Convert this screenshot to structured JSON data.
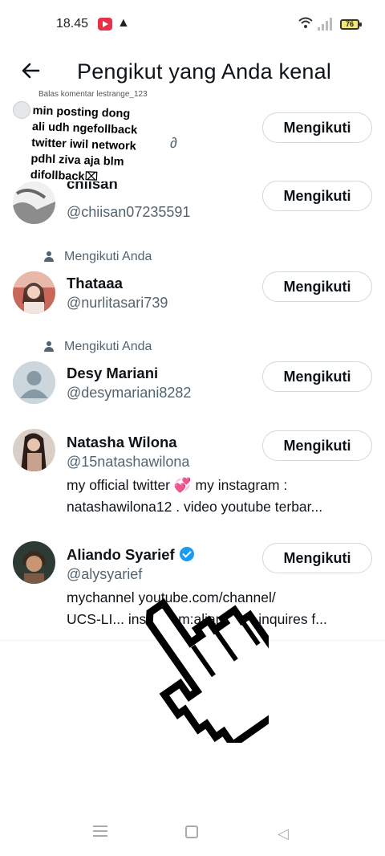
{
  "status_bar": {
    "time": "18.45",
    "battery": "76"
  },
  "header": {
    "title": "Pengikut yang Anda kenal"
  },
  "overlay_comment": {
    "reply_label": "Balas komentar lestrange_123",
    "lines": [
      "min posting dong",
      "ali udh ngefollback",
      "twitter iwil network",
      "pdhl ziva aja blm",
      "difollback⌧"
    ]
  },
  "users": [
    {
      "name": "",
      "handle": "",
      "follow_label": "Mengikuti"
    },
    {
      "name": "chiisan",
      "handle": "@chiisan07235591",
      "follow_label": "Mengikuti"
    },
    {
      "follows_you": "Mengikuti Anda",
      "name": "Thataaa",
      "handle": "@nurlitasari739",
      "follow_label": "Mengikuti"
    },
    {
      "follows_you": "Mengikuti Anda",
      "name": "Desy Mariani",
      "handle": "@desymariani8282",
      "follow_label": "Mengikuti"
    },
    {
      "name": "Natasha Wilona",
      "handle": "@15natashawilona",
      "bio_line1": "my official twitter 💞 my instagram :",
      "bio_line2": "natashawilona12 . video youtube terbar...",
      "follow_label": "Mengikuti"
    },
    {
      "name": "Aliando Syarief",
      "handle": "@alysyarief",
      "verified": true,
      "bio_line1": "mychannel youtube.com/channel/",
      "bio_line2": "UCS-LI... instagram:aliandooo inquires f...",
      "follow_label": "Mengikuti"
    }
  ],
  "colors": {
    "text_primary": "#0f1419",
    "text_secondary": "#536471",
    "verified": "#1d9bf0",
    "button_border": "#cfd9de"
  },
  "icons": [
    "back-arrow-icon",
    "person-icon",
    "verified-badge-icon",
    "hand-cursor-icon",
    "wifi-icon",
    "battery-icon"
  ]
}
